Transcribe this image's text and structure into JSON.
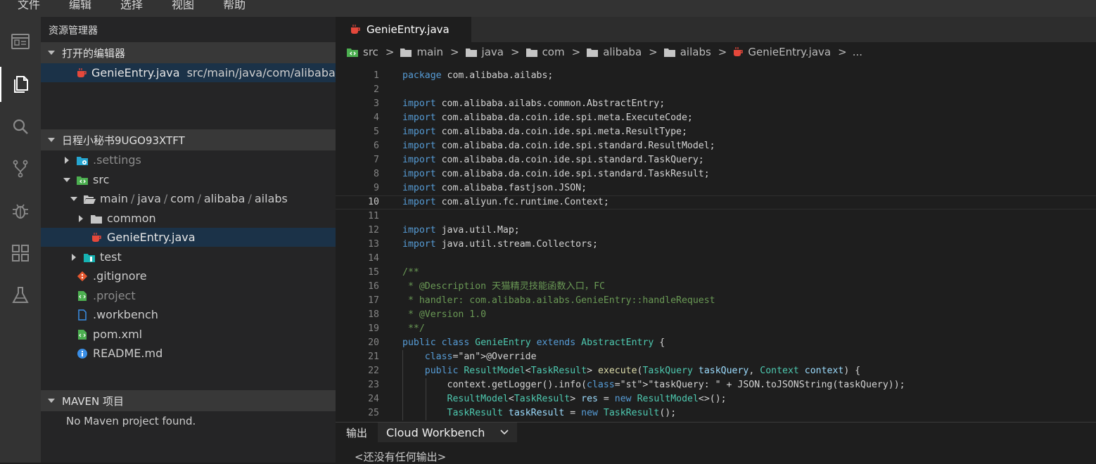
{
  "menu": [
    "文件",
    "编辑",
    "选择",
    "视图",
    "帮助"
  ],
  "sidebar": {
    "title": "资源管理器",
    "open_editors": {
      "header": "打开的编辑器",
      "file": "GenieEntry.java",
      "path": "src/main/java/com/alibaba/..."
    },
    "project": {
      "header": "日程小秘书9UGO93XTFT",
      "items": {
        "settings": ".settings",
        "src": "src",
        "main_path": [
          "main",
          "java",
          "com",
          "alibaba",
          "ailabs"
        ],
        "path_sep": "/",
        "common": "common",
        "genie": "GenieEntry.java",
        "test": "test",
        "gitignore": ".gitignore",
        "project_file": ".project",
        "workbench": ".workbench",
        "pom": "pom.xml",
        "readme": "README.md"
      }
    },
    "maven": {
      "header": "MAVEN 项目",
      "empty": "No Maven project found."
    }
  },
  "editor": {
    "tab": "GenieEntry.java",
    "breadcrumb": [
      "src",
      "main",
      "java",
      "com",
      "alibaba",
      "ailabs",
      "GenieEntry.java",
      "..."
    ],
    "current_line": 10,
    "lines": [
      "package com.alibaba.ailabs;",
      "",
      "import com.alibaba.ailabs.common.AbstractEntry;",
      "import com.alibaba.da.coin.ide.spi.meta.ExecuteCode;",
      "import com.alibaba.da.coin.ide.spi.meta.ResultType;",
      "import com.alibaba.da.coin.ide.spi.standard.ResultModel;",
      "import com.alibaba.da.coin.ide.spi.standard.TaskQuery;",
      "import com.alibaba.da.coin.ide.spi.standard.TaskResult;",
      "import com.alibaba.fastjson.JSON;",
      "import com.aliyun.fc.runtime.Context;",
      "",
      "import java.util.Map;",
      "import java.util.stream.Collectors;",
      "",
      "/**",
      " * @Description 天猫精灵技能函数入口，FC",
      " * handler: com.alibaba.ailabs.GenieEntry::handleRequest",
      " * @Version 1.0",
      " **/",
      "public class GenieEntry extends AbstractEntry {",
      "    @Override",
      "    public ResultModel<TaskResult> execute(TaskQuery taskQuery, Context context) {",
      "        context.getLogger().info(\"taskQuery: \" + JSON.toJSONString(taskQuery));",
      "        ResultModel<TaskResult> res = new ResultModel<>();",
      "        TaskResult taskResult = new TaskResult();"
    ]
  },
  "panel": {
    "tab_output": "输出",
    "channel": "Cloud Workbench",
    "message": "<还没有任何输出>"
  },
  "colors": {
    "java_icon": "#e5483b",
    "folder_icon": "#c5c5c5",
    "src_icon": "#4caf50",
    "settings_icon": "#26a6d1",
    "test_icon": "#16b3b3",
    "git_icon": "#e4572e",
    "readme_icon": "#3a8ee6"
  }
}
